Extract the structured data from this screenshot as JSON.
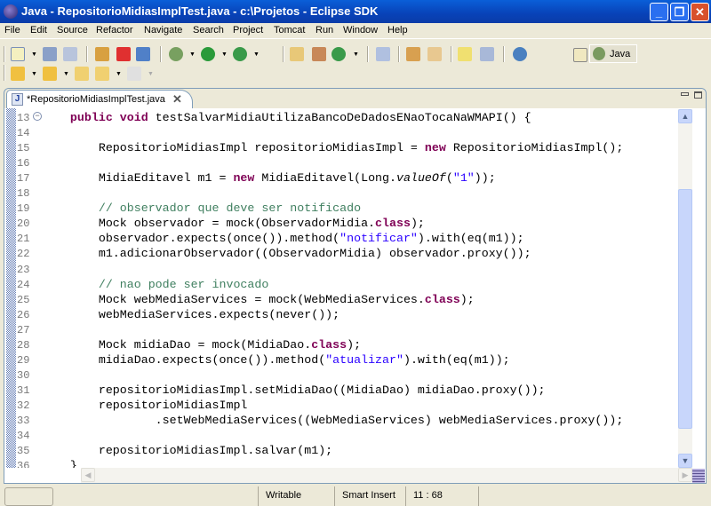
{
  "window": {
    "title": "Java - RepositorioMidiasImplTest.java - c:\\Projetos - Eclipse SDK",
    "minimize": "_",
    "restore": "❐",
    "close": "✕"
  },
  "menu": [
    "File",
    "Edit",
    "Source",
    "Refactor",
    "Navigate",
    "Search",
    "Project",
    "Tomcat",
    "Run",
    "Window",
    "Help"
  ],
  "perspective": {
    "label": "Java"
  },
  "editor": {
    "tab_label": "*RepositorioMidiasImplTest.java",
    "tab_close": "✕"
  },
  "code": [
    {
      "n": "13",
      "t": [
        [
          "    ",
          ""
        ],
        [
          "public",
          "k"
        ],
        [
          " ",
          ""
        ],
        [
          "void",
          "k"
        ],
        [
          " testSalvarMidiaUtilizaBancoDeDadosENaoTocaNaWMAPI() {",
          ""
        ]
      ]
    },
    {
      "n": "14",
      "t": []
    },
    {
      "n": "15",
      "t": [
        [
          "        RepositorioMidiasImpl repositorioMidiasImpl = ",
          ""
        ],
        [
          "new",
          "k"
        ],
        [
          " RepositorioMidiasImpl();",
          ""
        ]
      ]
    },
    {
      "n": "16",
      "t": []
    },
    {
      "n": "17",
      "t": [
        [
          "        MidiaEditavel m1 = ",
          ""
        ],
        [
          "new",
          "k"
        ],
        [
          " MidiaEditavel(Long.",
          ""
        ],
        [
          "valueOf",
          "i"
        ],
        [
          "(",
          ""
        ],
        [
          "\"1\"",
          "s"
        ],
        [
          "));",
          ""
        ]
      ]
    },
    {
      "n": "18",
      "t": []
    },
    {
      "n": "19",
      "t": [
        [
          "        // observador que deve ser notificado",
          "c"
        ]
      ]
    },
    {
      "n": "20",
      "t": [
        [
          "        Mock observador = mock(ObservadorMidia.",
          ""
        ],
        [
          "class",
          "k"
        ],
        [
          ");",
          ""
        ]
      ]
    },
    {
      "n": "21",
      "t": [
        [
          "        observador.expects(once()).method(",
          ""
        ],
        [
          "\"notificar\"",
          "s"
        ],
        [
          ").with(eq(m1));",
          ""
        ]
      ]
    },
    {
      "n": "22",
      "t": [
        [
          "        m1.adicionarObservador((ObservadorMidia) observador.proxy());",
          ""
        ]
      ]
    },
    {
      "n": "23",
      "t": []
    },
    {
      "n": "24",
      "t": [
        [
          "        // nao pode ser invocado",
          "c"
        ]
      ]
    },
    {
      "n": "25",
      "t": [
        [
          "        Mock webMediaServices = mock(WebMediaServices.",
          ""
        ],
        [
          "class",
          "k"
        ],
        [
          ");",
          ""
        ]
      ]
    },
    {
      "n": "26",
      "t": [
        [
          "        webMediaServices.expects(never());",
          ""
        ]
      ]
    },
    {
      "n": "27",
      "t": []
    },
    {
      "n": "28",
      "t": [
        [
          "        Mock midiaDao = mock(MidiaDao.",
          ""
        ],
        [
          "class",
          "k"
        ],
        [
          ");",
          ""
        ]
      ]
    },
    {
      "n": "29",
      "t": [
        [
          "        midiaDao.expects(once()).method(",
          ""
        ],
        [
          "\"atualizar\"",
          "s"
        ],
        [
          ").with(eq(m1));",
          ""
        ]
      ]
    },
    {
      "n": "30",
      "t": []
    },
    {
      "n": "31",
      "t": [
        [
          "        repositorioMidiasImpl.setMidiaDao((MidiaDao) midiaDao.proxy());",
          ""
        ]
      ]
    },
    {
      "n": "32",
      "t": [
        [
          "        repositorioMidiasImpl",
          ""
        ]
      ]
    },
    {
      "n": "33",
      "t": [
        [
          "                .setWebMediaServices((WebMediaServices) webMediaServices.proxy());",
          ""
        ]
      ]
    },
    {
      "n": "34",
      "t": []
    },
    {
      "n": "35",
      "t": [
        [
          "        repositorioMidiasImpl.salvar(m1);",
          ""
        ]
      ]
    },
    {
      "n": "36",
      "t": [
        [
          "    }",
          ""
        ]
      ]
    }
  ],
  "status": {
    "mode": "Writable",
    "insert": "Smart Insert",
    "position": "11 : 68"
  },
  "colors": {
    "keyword": "#7f0055",
    "string": "#2a00ff",
    "comment": "#3f7f5f",
    "titlebar": "#0842b8"
  }
}
